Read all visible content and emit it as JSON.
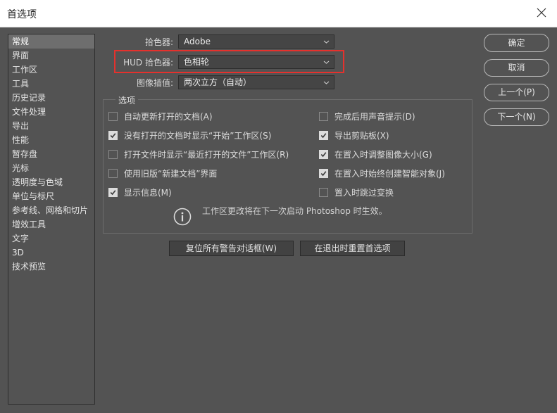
{
  "window": {
    "title": "首选项"
  },
  "sidebar": {
    "items": [
      "常规",
      "界面",
      "工作区",
      "工具",
      "历史记录",
      "文件处理",
      "导出",
      "性能",
      "暂存盘",
      "光标",
      "透明度与色域",
      "单位与标尺",
      "参考线、网格和切片",
      "增效工具",
      "文字",
      "3D",
      "技术预览"
    ],
    "selected": "常规"
  },
  "fields": {
    "color_picker": {
      "label": "拾色器:",
      "value": "Adobe"
    },
    "hud_color_picker": {
      "label": "HUD 拾色器:",
      "value": "色相轮"
    },
    "interpolation": {
      "label": "图像插值:",
      "value": "两次立方（自动）"
    }
  },
  "options": {
    "title": "选项",
    "left": [
      {
        "label": "自动更新打开的文档(A)",
        "checked": false
      },
      {
        "label": "没有打开的文档时显示“开始”工作区(S)",
        "checked": true
      },
      {
        "label": "打开文件时显示“最近打开的文件”工作区(R)",
        "checked": false
      },
      {
        "label": "使用旧版“新建文档”界面",
        "checked": false
      },
      {
        "label": "显示信息(M)",
        "checked": true
      }
    ],
    "right": [
      {
        "label": "完成后用声音提示(D)",
        "checked": false
      },
      {
        "label": "导出剪贴板(X)",
        "checked": true
      },
      {
        "label": "在置入时调整图像大小(G)",
        "checked": true
      },
      {
        "label": "在置入时始终创建智能对象(J)",
        "checked": true
      },
      {
        "label": "置入时跳过变换",
        "checked": false
      }
    ],
    "info": "工作区更改将在下一次启动 Photoshop 时生效。"
  },
  "reset_buttons": {
    "reset_warnings": "复位所有警告对话框(W)",
    "reset_on_quit": "在退出时重置首选项"
  },
  "actions": {
    "ok": "确定",
    "cancel": "取消",
    "prev": "上一个(P)",
    "next": "下一个(N)"
  }
}
